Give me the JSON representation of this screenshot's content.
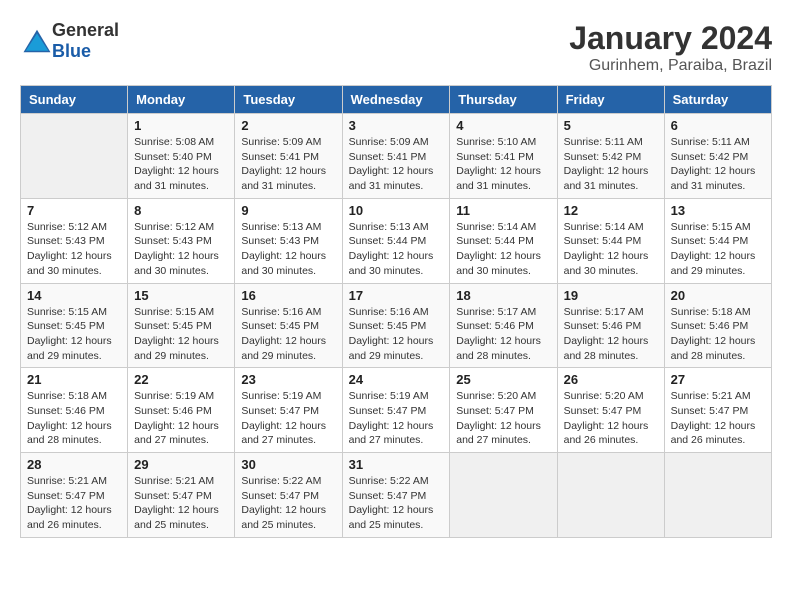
{
  "logo": {
    "general": "General",
    "blue": "Blue"
  },
  "title": {
    "month": "January 2024",
    "location": "Gurinhem, Paraiba, Brazil"
  },
  "calendar": {
    "headers": [
      "Sunday",
      "Monday",
      "Tuesday",
      "Wednesday",
      "Thursday",
      "Friday",
      "Saturday"
    ],
    "weeks": [
      [
        {
          "day": "",
          "info": ""
        },
        {
          "day": "1",
          "info": "Sunrise: 5:08 AM\nSunset: 5:40 PM\nDaylight: 12 hours\nand 31 minutes."
        },
        {
          "day": "2",
          "info": "Sunrise: 5:09 AM\nSunset: 5:41 PM\nDaylight: 12 hours\nand 31 minutes."
        },
        {
          "day": "3",
          "info": "Sunrise: 5:09 AM\nSunset: 5:41 PM\nDaylight: 12 hours\nand 31 minutes."
        },
        {
          "day": "4",
          "info": "Sunrise: 5:10 AM\nSunset: 5:41 PM\nDaylight: 12 hours\nand 31 minutes."
        },
        {
          "day": "5",
          "info": "Sunrise: 5:11 AM\nSunset: 5:42 PM\nDaylight: 12 hours\nand 31 minutes."
        },
        {
          "day": "6",
          "info": "Sunrise: 5:11 AM\nSunset: 5:42 PM\nDaylight: 12 hours\nand 31 minutes."
        }
      ],
      [
        {
          "day": "7",
          "info": "Sunrise: 5:12 AM\nSunset: 5:43 PM\nDaylight: 12 hours\nand 30 minutes."
        },
        {
          "day": "8",
          "info": "Sunrise: 5:12 AM\nSunset: 5:43 PM\nDaylight: 12 hours\nand 30 minutes."
        },
        {
          "day": "9",
          "info": "Sunrise: 5:13 AM\nSunset: 5:43 PM\nDaylight: 12 hours\nand 30 minutes."
        },
        {
          "day": "10",
          "info": "Sunrise: 5:13 AM\nSunset: 5:44 PM\nDaylight: 12 hours\nand 30 minutes."
        },
        {
          "day": "11",
          "info": "Sunrise: 5:14 AM\nSunset: 5:44 PM\nDaylight: 12 hours\nand 30 minutes."
        },
        {
          "day": "12",
          "info": "Sunrise: 5:14 AM\nSunset: 5:44 PM\nDaylight: 12 hours\nand 30 minutes."
        },
        {
          "day": "13",
          "info": "Sunrise: 5:15 AM\nSunset: 5:44 PM\nDaylight: 12 hours\nand 29 minutes."
        }
      ],
      [
        {
          "day": "14",
          "info": "Sunrise: 5:15 AM\nSunset: 5:45 PM\nDaylight: 12 hours\nand 29 minutes."
        },
        {
          "day": "15",
          "info": "Sunrise: 5:15 AM\nSunset: 5:45 PM\nDaylight: 12 hours\nand 29 minutes."
        },
        {
          "day": "16",
          "info": "Sunrise: 5:16 AM\nSunset: 5:45 PM\nDaylight: 12 hours\nand 29 minutes."
        },
        {
          "day": "17",
          "info": "Sunrise: 5:16 AM\nSunset: 5:45 PM\nDaylight: 12 hours\nand 29 minutes."
        },
        {
          "day": "18",
          "info": "Sunrise: 5:17 AM\nSunset: 5:46 PM\nDaylight: 12 hours\nand 28 minutes."
        },
        {
          "day": "19",
          "info": "Sunrise: 5:17 AM\nSunset: 5:46 PM\nDaylight: 12 hours\nand 28 minutes."
        },
        {
          "day": "20",
          "info": "Sunrise: 5:18 AM\nSunset: 5:46 PM\nDaylight: 12 hours\nand 28 minutes."
        }
      ],
      [
        {
          "day": "21",
          "info": "Sunrise: 5:18 AM\nSunset: 5:46 PM\nDaylight: 12 hours\nand 28 minutes."
        },
        {
          "day": "22",
          "info": "Sunrise: 5:19 AM\nSunset: 5:46 PM\nDaylight: 12 hours\nand 27 minutes."
        },
        {
          "day": "23",
          "info": "Sunrise: 5:19 AM\nSunset: 5:47 PM\nDaylight: 12 hours\nand 27 minutes."
        },
        {
          "day": "24",
          "info": "Sunrise: 5:19 AM\nSunset: 5:47 PM\nDaylight: 12 hours\nand 27 minutes."
        },
        {
          "day": "25",
          "info": "Sunrise: 5:20 AM\nSunset: 5:47 PM\nDaylight: 12 hours\nand 27 minutes."
        },
        {
          "day": "26",
          "info": "Sunrise: 5:20 AM\nSunset: 5:47 PM\nDaylight: 12 hours\nand 26 minutes."
        },
        {
          "day": "27",
          "info": "Sunrise: 5:21 AM\nSunset: 5:47 PM\nDaylight: 12 hours\nand 26 minutes."
        }
      ],
      [
        {
          "day": "28",
          "info": "Sunrise: 5:21 AM\nSunset: 5:47 PM\nDaylight: 12 hours\nand 26 minutes."
        },
        {
          "day": "29",
          "info": "Sunrise: 5:21 AM\nSunset: 5:47 PM\nDaylight: 12 hours\nand 25 minutes."
        },
        {
          "day": "30",
          "info": "Sunrise: 5:22 AM\nSunset: 5:47 PM\nDaylight: 12 hours\nand 25 minutes."
        },
        {
          "day": "31",
          "info": "Sunrise: 5:22 AM\nSunset: 5:47 PM\nDaylight: 12 hours\nand 25 minutes."
        },
        {
          "day": "",
          "info": ""
        },
        {
          "day": "",
          "info": ""
        },
        {
          "day": "",
          "info": ""
        }
      ]
    ]
  }
}
